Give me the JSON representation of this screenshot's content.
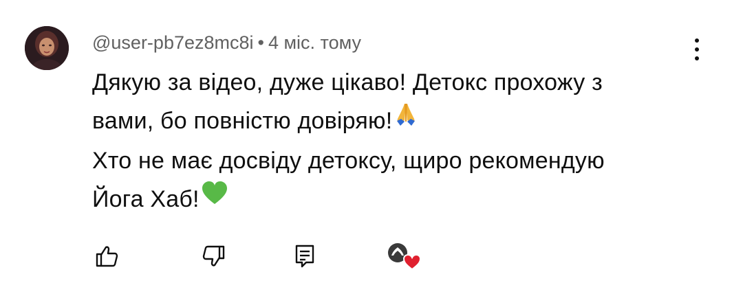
{
  "comment": {
    "author": "@user-pb7ez8mc8i",
    "separator": "•",
    "time_ago": "4 міс. тому",
    "text_lines": [
      "Дякую за відео, дуже цікаво! Детокс прохожу з",
      "вами, бо повністю довіряю!",
      "Хто не має досвіду детоксу, щиро рекомендую",
      "Йога Хаб!"
    ],
    "emojis": [
      "folded-hands-emoji",
      "green-heart-emoji"
    ]
  },
  "actions": {
    "like_icon": "thumbs-up-icon",
    "dislike_icon": "thumbs-down-icon",
    "reply_icon": "reply-icon",
    "creator_heart_icon": "creator-heart-icon"
  },
  "colors": {
    "secondary_text": "#606060",
    "primary_text": "#0f0f0f",
    "heart_red": "#e0202f",
    "green_heart": "#58b947",
    "folded_hands": "#f2b53b"
  }
}
